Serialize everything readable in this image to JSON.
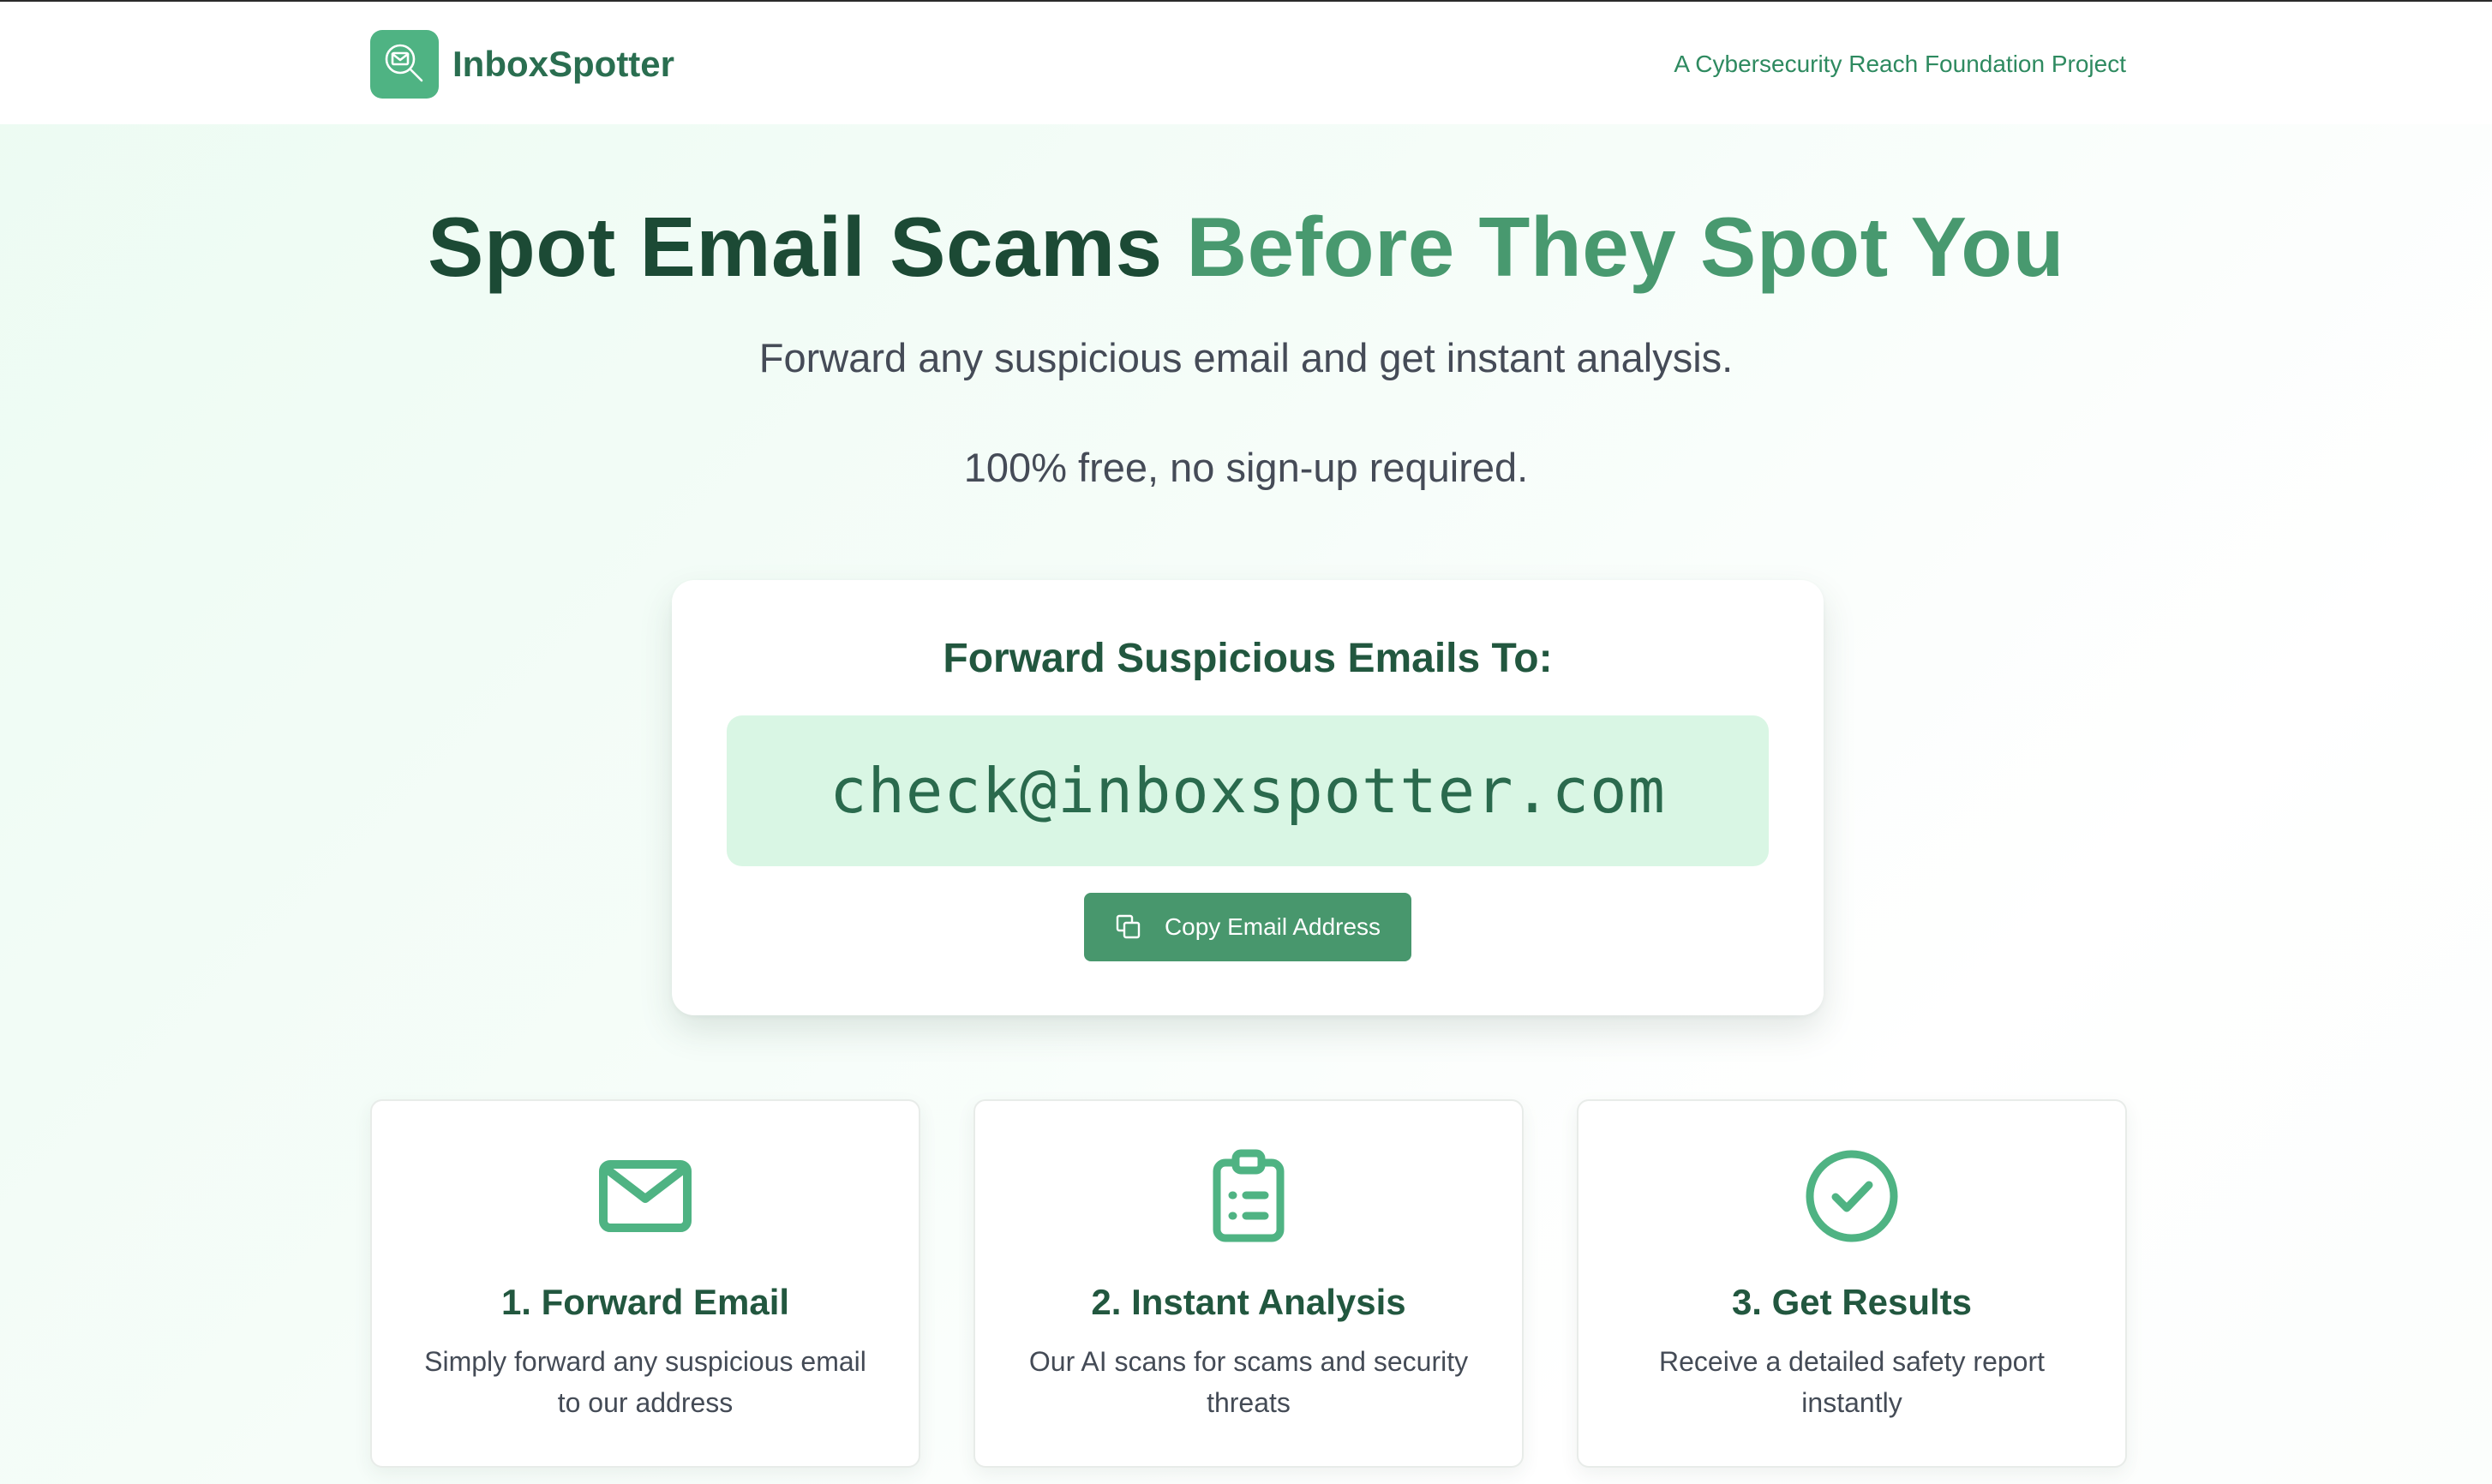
{
  "header": {
    "brand": "InboxSpotter",
    "tagline": "A Cybersecurity Reach Foundation Project",
    "logo_icon": "envelope-magnifier-icon"
  },
  "hero": {
    "title_part1": "Spot Email Scams",
    "title_part2": "Before They Spot You",
    "subtitle_line1": "Forward any suspicious email and get instant analysis.",
    "subtitle_line2": "100% free, no sign-up required."
  },
  "forward_card": {
    "title": "Forward Suspicious Emails To:",
    "email": "check@inboxspotter.com",
    "copy_button_label": "Copy Email Address",
    "copy_icon": "copy-icon"
  },
  "steps": [
    {
      "icon": "envelope-icon",
      "title": "1. Forward Email",
      "description": "Simply forward any suspicious email to our address"
    },
    {
      "icon": "clipboard-list-icon",
      "title": "2. Instant Analysis",
      "description": "Our AI scans for scams and security threats"
    },
    {
      "icon": "check-circle-icon",
      "title": "3. Get Results",
      "description": "Receive a detailed safety report instantly"
    }
  ],
  "colors": {
    "brand_green": "#4fb383",
    "dark_green": "#1c4a35",
    "accent_green": "#48996f",
    "email_box_bg": "#d9f6e4",
    "button_bg": "#48976d"
  }
}
